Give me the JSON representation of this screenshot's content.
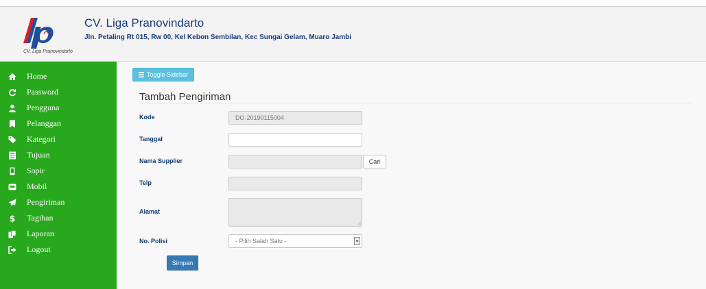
{
  "header": {
    "logo_caption": "CV. Liga Pranovindarto",
    "company_name": "CV. Liga Pranovindarto",
    "address": "Jln. Petaling Rt 015, Rw 00, Kel Kebon Sembilan, Kec Sungai Gelam, Muaro Jambi"
  },
  "sidebar": {
    "items": [
      {
        "label": "Home",
        "icon": "home-icon"
      },
      {
        "label": "Password",
        "icon": "refresh-icon"
      },
      {
        "label": "Pengguna",
        "icon": "user-icon"
      },
      {
        "label": "Pelanggan",
        "icon": "bookmark-icon"
      },
      {
        "label": "Kategori",
        "icon": "tags-icon"
      },
      {
        "label": "Tujuan",
        "icon": "list-alt-icon"
      },
      {
        "label": "Sopir",
        "icon": "phone-icon"
      },
      {
        "label": "Mobil",
        "icon": "hdd-icon"
      },
      {
        "label": "Pengiriman",
        "icon": "send-icon"
      },
      {
        "label": "Tagihan",
        "icon": "dollar-icon"
      },
      {
        "label": "Laporan",
        "icon": "copy-icon"
      },
      {
        "label": "Logout",
        "icon": "logout-icon"
      }
    ]
  },
  "main": {
    "toggle_label": "Toggle Sidebar",
    "title": "Tambah Pengiriman",
    "form": {
      "kode_label": "Kode",
      "kode_value": "DO-20190115004",
      "tanggal_label": "Tanggal",
      "tanggal_value": "",
      "supplier_label": "Nama Supplier",
      "supplier_value": "",
      "cari_label": "Cari",
      "telp_label": "Telp",
      "telp_value": "",
      "alamat_label": "Alamat",
      "alamat_value": "",
      "polisi_label": "No. Polisi",
      "polisi_selected": "- Pilih Salah Satu -",
      "submit_label": "Simpan"
    }
  },
  "colors": {
    "sidebar_bg": "#28a81c",
    "header_text": "#1a3a7a",
    "label_text": "#0f3a70",
    "toggle_button": "#5bc0de",
    "primary_button": "#337ab7",
    "logo_red": "#d62027",
    "logo_blue": "#1f4e9c"
  }
}
